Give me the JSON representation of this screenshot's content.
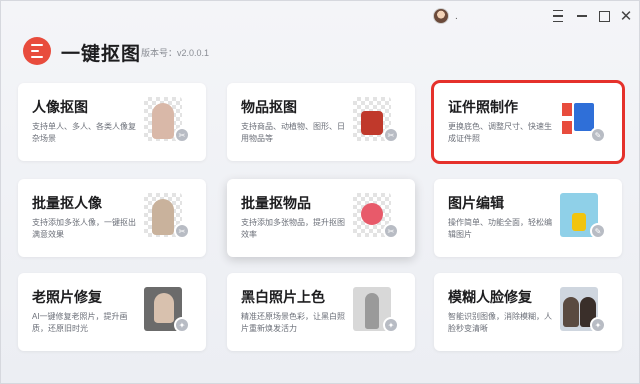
{
  "app": {
    "title": "一键抠图",
    "version": "版本号：v2.0.0.1",
    "avatar_suffix": "."
  },
  "window_controls": {
    "menu": "menu-icon",
    "minimize": "minimize-icon",
    "maximize": "maximize-icon",
    "close_glyph": "✕"
  },
  "cards": [
    {
      "title": "人像抠图",
      "desc": "支持单人、多人、各类人像复杂场景",
      "thumb_color": "#d9b8a8"
    },
    {
      "title": "物品抠图",
      "desc": "支持商品、动植物、图形、日用物品等",
      "thumb_color": "#c0392b"
    },
    {
      "title": "证件照制作",
      "desc": "更换底色、调整尺寸、快速生成证件照",
      "thumb_color": "#2f6fd8",
      "selected": true
    },
    {
      "title": "批量抠人像",
      "desc": "支持添加多张人像，一键抠出满意效果",
      "thumb_color": "#c9b29c"
    },
    {
      "title": "批量抠物品",
      "desc": "支持添加多张物品，提升抠图效率",
      "thumb_color": "#e85a6a"
    },
    {
      "title": "图片编辑",
      "desc": "操作简单、功能全面，轻松编辑图片",
      "thumb_color": "#8fd0e8"
    },
    {
      "title": "老照片修复",
      "desc": "AI一键修复老照片，提升画质，还原旧时光",
      "thumb_color": "#6b6b6b"
    },
    {
      "title": "黑白照片上色",
      "desc": "精准还原场景色彩，让黑白照片重新焕发活力",
      "thumb_color": "#9a9a9a"
    },
    {
      "title": "模糊人脸修复",
      "desc": "智能识别图像，消除模糊，人脸秒变清晰",
      "thumb_color": "#5a4a40"
    }
  ],
  "colors": {
    "accent": "#e84c3d",
    "selection": "#e5312b"
  }
}
